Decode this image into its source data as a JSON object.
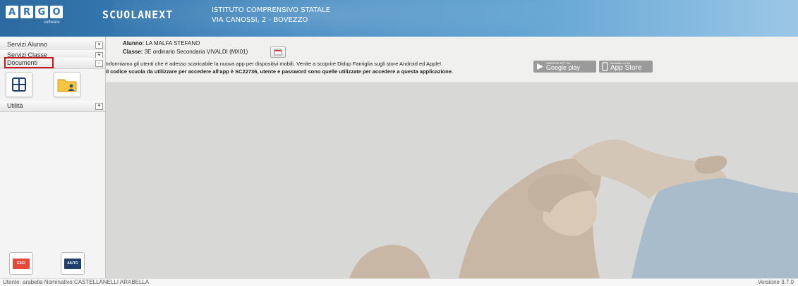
{
  "header": {
    "logo_letters": [
      "A",
      "R",
      "G",
      "O"
    ],
    "logo_subtext": "software",
    "brand": "SCUOLANEXT",
    "school_name": "ISTITUTO COMPRENSIVO STATALE",
    "school_address": "VIA CANOSSI, 2 - BOVEZZO"
  },
  "sidebar": {
    "menus": [
      {
        "label": "Servizi Alunno",
        "toggle": "▾"
      },
      {
        "label": "Servizi Classe",
        "toggle": "▾"
      },
      {
        "label": "Documenti",
        "toggle": "–"
      },
      {
        "label": "Utilità",
        "toggle": "▾"
      }
    ],
    "documenti_icons": [
      "grid-icon",
      "folder-user-icon"
    ],
    "exit_label": "ESCI",
    "help_label": "AIUTO",
    "colors": {
      "exit": "#e34b3b",
      "help": "#1f3f6e",
      "highlight": "#c7141c"
    }
  },
  "main": {
    "student_label": "Alunno:",
    "student_name": "LA MALFA STEFANO",
    "class_label": "Classe:",
    "class_value": "3E ordinario Secondaria VIVALDI (MX01)",
    "notice": "Informiamo gli utenti che è adesso scaricabile la nuova app per dispositivi mobili. Venite a scoprire Didup Famiglia sugli store Android ed Apple!",
    "code_notice": "Il codice scuola da utilizzare per accedere all'app è SC22736, utente e password sono quelle utilizzate per accedere a questa applicazione.",
    "google_play": {
      "small": "ANDROID APP ON",
      "big": "Google play"
    },
    "app_store": {
      "small": "Available on the",
      "big": "App Store"
    }
  },
  "statusbar": {
    "user_info": "Utente: arabella Nominativo:CASTELLANELLI ARABELLA",
    "version": "Versione 3.7.0"
  }
}
